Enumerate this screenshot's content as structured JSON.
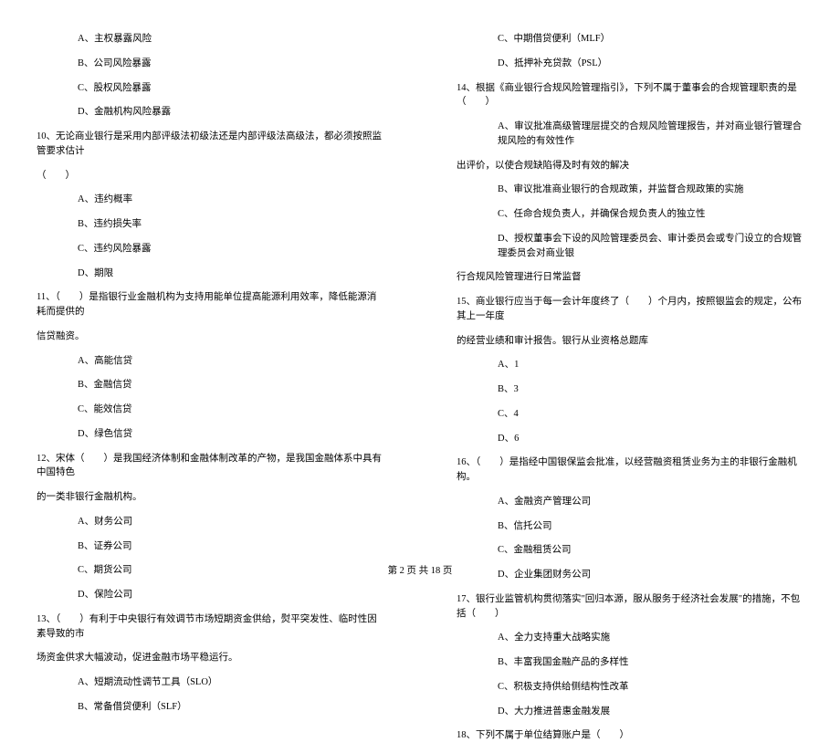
{
  "left": {
    "l01": "A、主权暴露风险",
    "l02": "B、公司风险暴露",
    "l03": "C、股权风险暴露",
    "l04": "D、金融机构风险暴露",
    "l05": "10、无论商业银行是采用内部评级法初级法还是内部评级法高级法，都必须按照监管要求估计",
    "l06": "（　　）",
    "l07": "A、违约概率",
    "l08": "B、违约损失率",
    "l09": "C、违约风险暴露",
    "l10": "D、期限",
    "l11": "11、（　　）是指银行业金融机构为支持用能单位提高能源利用效率，降低能源消耗而提供的",
    "l12": "信贷融资。",
    "l13": "A、高能信贷",
    "l14": "B、金融信贷",
    "l15": "C、能效信贷",
    "l16": "D、绿色信贷",
    "l17": "12、宋体（　　）是我国经济体制和金融体制改革的产物，是我国金融体系中具有中国特色",
    "l18": "的一类非银行金融机构。",
    "l19": "A、财务公司",
    "l20": "B、证券公司",
    "l21": "C、期货公司",
    "l22": "D、保险公司",
    "l23": "13、（　　）有利于中央银行有效调节市场短期资金供给，熨平突发性、临时性因素导致的市",
    "l24": "场资金供求大幅波动，促进金融市场平稳运行。",
    "l25": "A、短期流动性调节工具（SLO）",
    "l26": "B、常备借贷便利（SLF）"
  },
  "right": {
    "r01": "C、中期借贷便利（MLF）",
    "r02": "D、抵押补充贷款（PSL）",
    "r03": "14、根据《商业银行合规风险管理指引》，下列不属于董事会的合规管理职责的是（　　）",
    "r04": "A、审议批准高级管理层提交的合规风险管理报告，并对商业银行管理合规风险的有效性作",
    "r05": "出评价，以使合规缺陷得及时有效的解决",
    "r06": "B、审议批准商业银行的合规政策，并监督合规政策的实施",
    "r07": "C、任命合规负责人，并确保合规负责人的独立性",
    "r08": "D、授权董事会下设的风险管理委员会、审计委员会或专门设立的合规管理委员会对商业银",
    "r09": "行合规风险管理进行日常监督",
    "r10": "15、商业银行应当于每一会计年度终了（　　）个月内，按照银监会的规定，公布其上一年度",
    "r11": "的经营业绩和审计报告。银行从业资格总题库",
    "r12": "A、1",
    "r13": "B、3",
    "r14": "C、4",
    "r15": "D、6",
    "r16": "16、（　　）是指经中国银保监会批准，以经营融资租赁业务为主的非银行金融机构。",
    "r17": "A、金融资产管理公司",
    "r18": "B、信托公司",
    "r19": "C、金融租赁公司",
    "r20": "D、企业集团财务公司",
    "r21": "17、银行业监管机构贯彻落实\"回归本源，服从服务于经济社会发展\"的措施，不包括（　　）",
    "r22": "A、全力支持重大战略实施",
    "r23": "B、丰富我国金融产品的多样性",
    "r24": "C、积极支持供给侧结构性改革",
    "r25": "D、大力推进普惠金融发展",
    "r26": "18、下列不属于单位结算账户是（　　）"
  },
  "footer": "第 2 页 共 18 页"
}
